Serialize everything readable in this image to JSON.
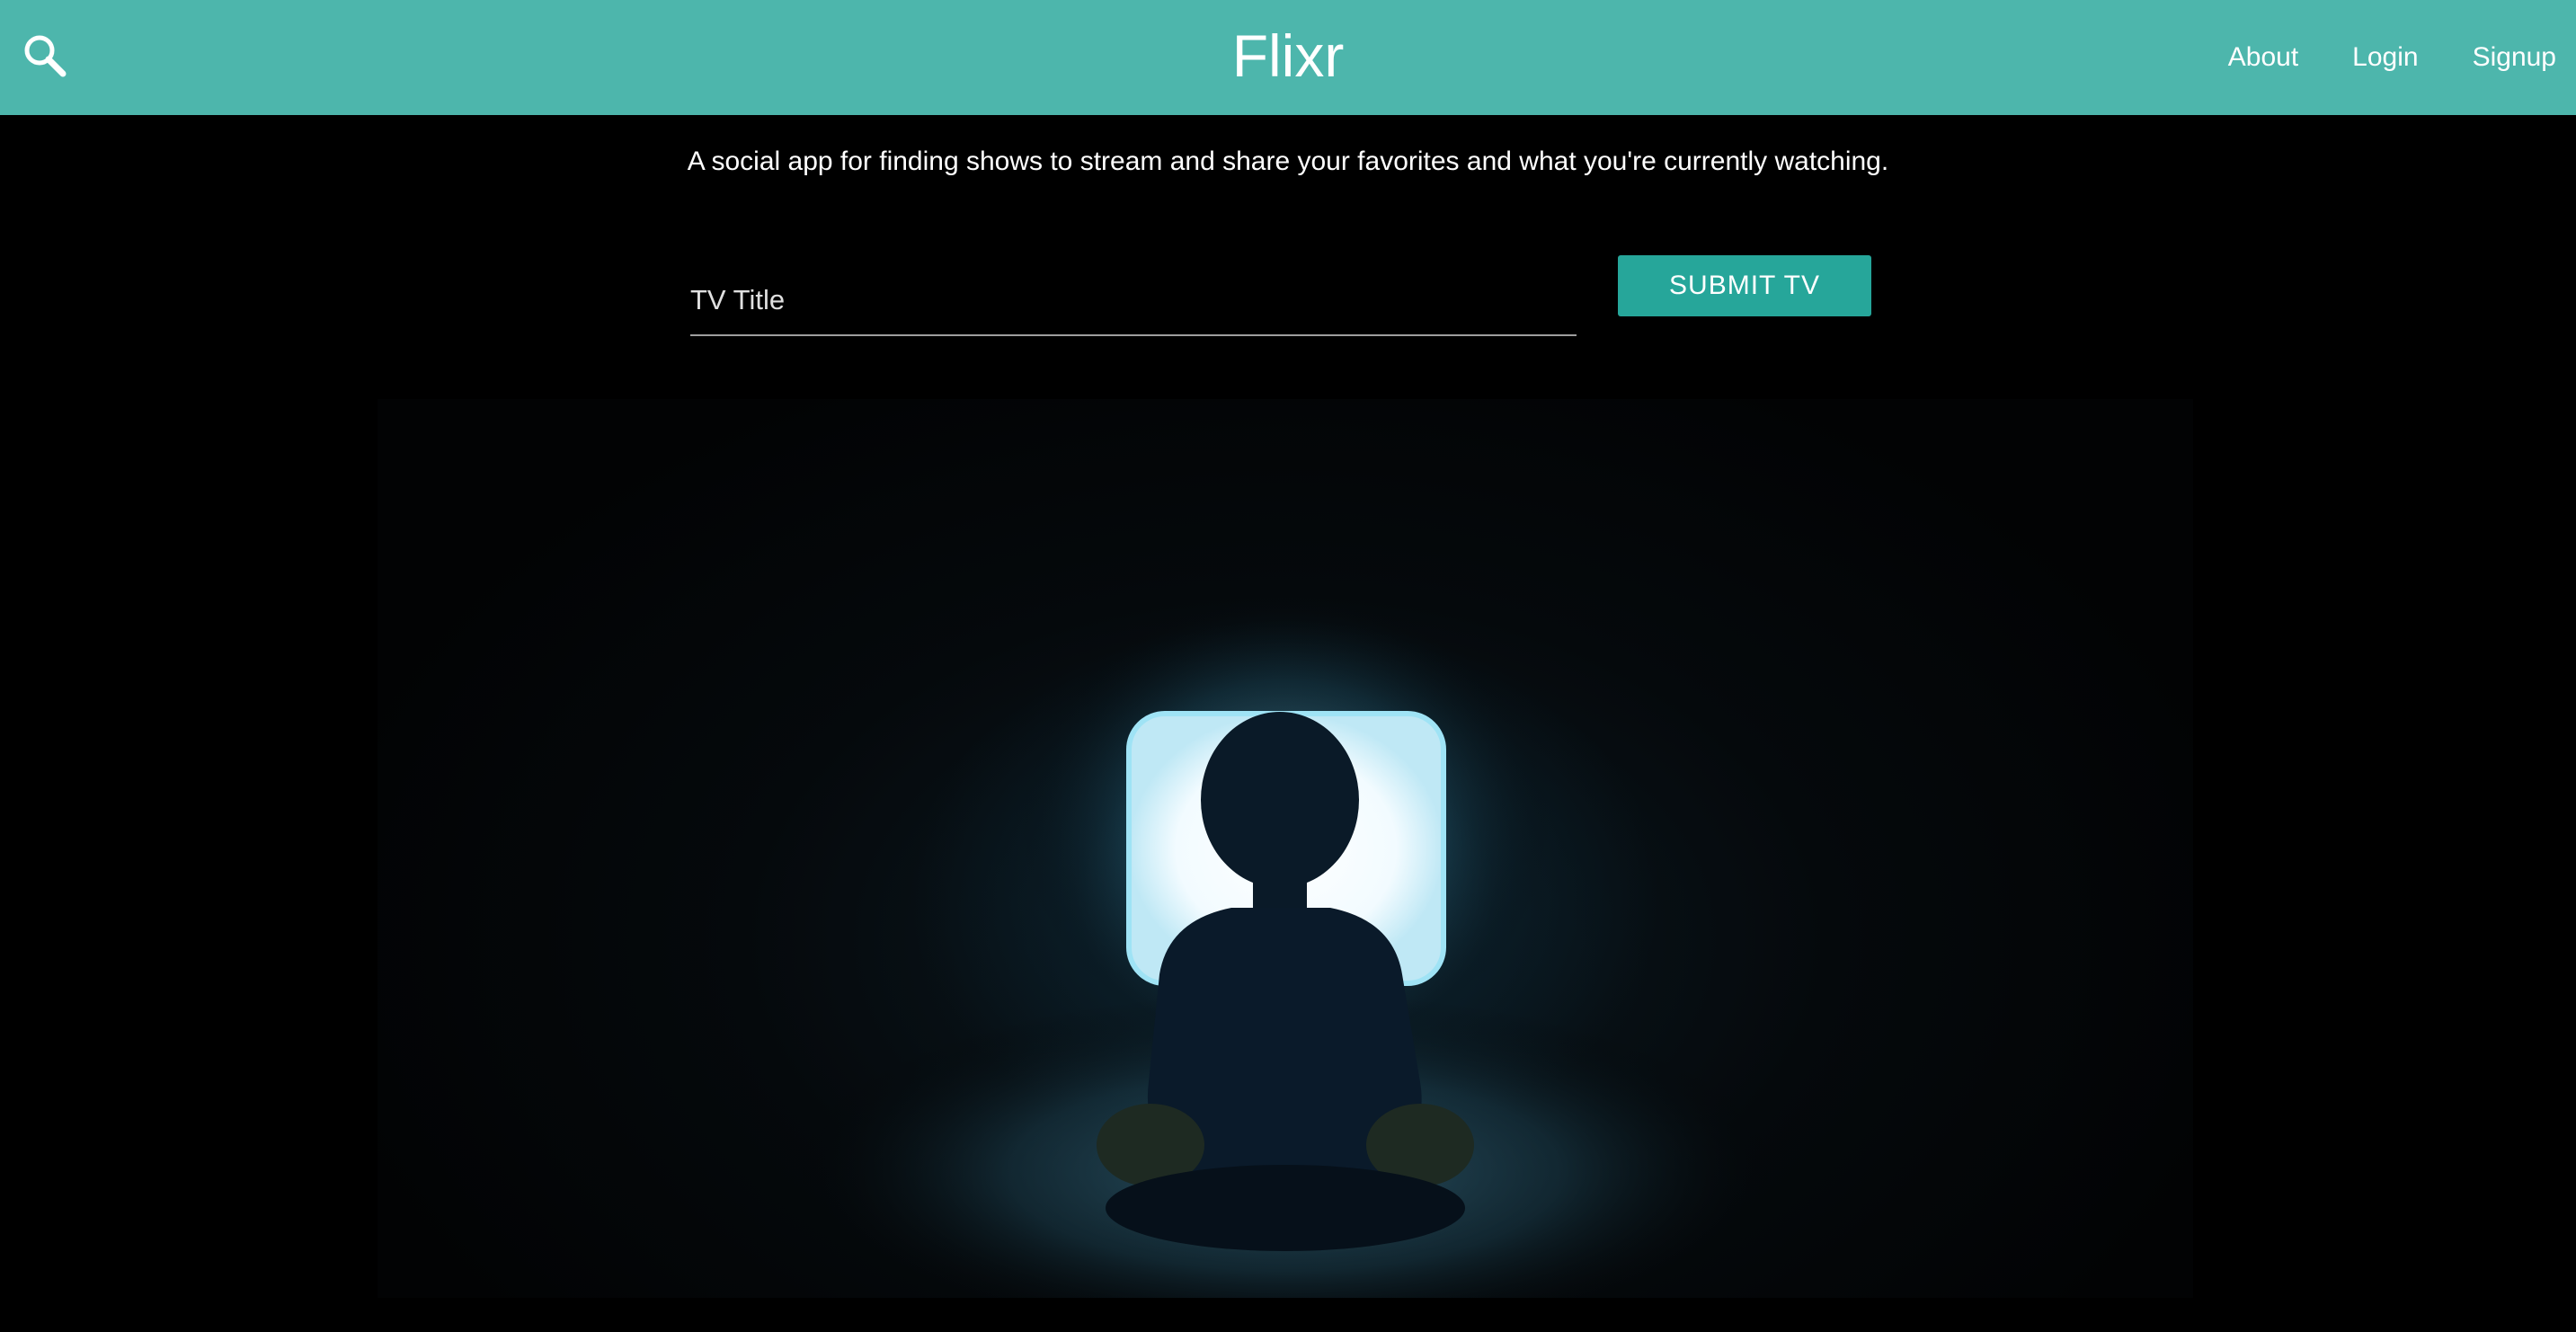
{
  "navbar": {
    "brand": "Flixr",
    "links": [
      "About",
      "Login",
      "Signup"
    ],
    "search_icon": "search-icon",
    "background_color": "#4db6ac"
  },
  "main": {
    "tagline": "A social app for finding shows to stream and share your favorites and what you're currently watching.",
    "tv_title": {
      "placeholder": "TV Title",
      "value": ""
    },
    "submit_label": "Submit TV",
    "submit_color": "#26a69a"
  }
}
